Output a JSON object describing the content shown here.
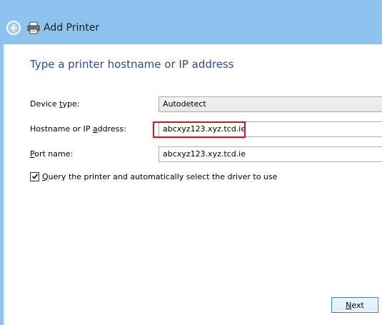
{
  "window": {
    "title": "Add Printer",
    "back_icon": "back-arrow-icon",
    "printer_icon": "printer-icon"
  },
  "page": {
    "heading": "Type a printer hostname or IP address"
  },
  "form": {
    "device_type_label": "Device type:",
    "device_type_value": "Autodetect",
    "hostname_label": "Hostname or IP address:",
    "hostname_value": "abcxyz123.xyz.tcd.ie",
    "port_label": "Port name:",
    "port_value": "abcxyz123.xyz.tcd.ie",
    "query_checkbox_label": "Query the printer and automatically select the driver to use",
    "query_checkbox_checked": true
  },
  "footer": {
    "next_label": "Next"
  },
  "colors": {
    "background": "#8fc3ef",
    "heading": "#2a4a9c",
    "highlight_border": "#e0121b"
  }
}
